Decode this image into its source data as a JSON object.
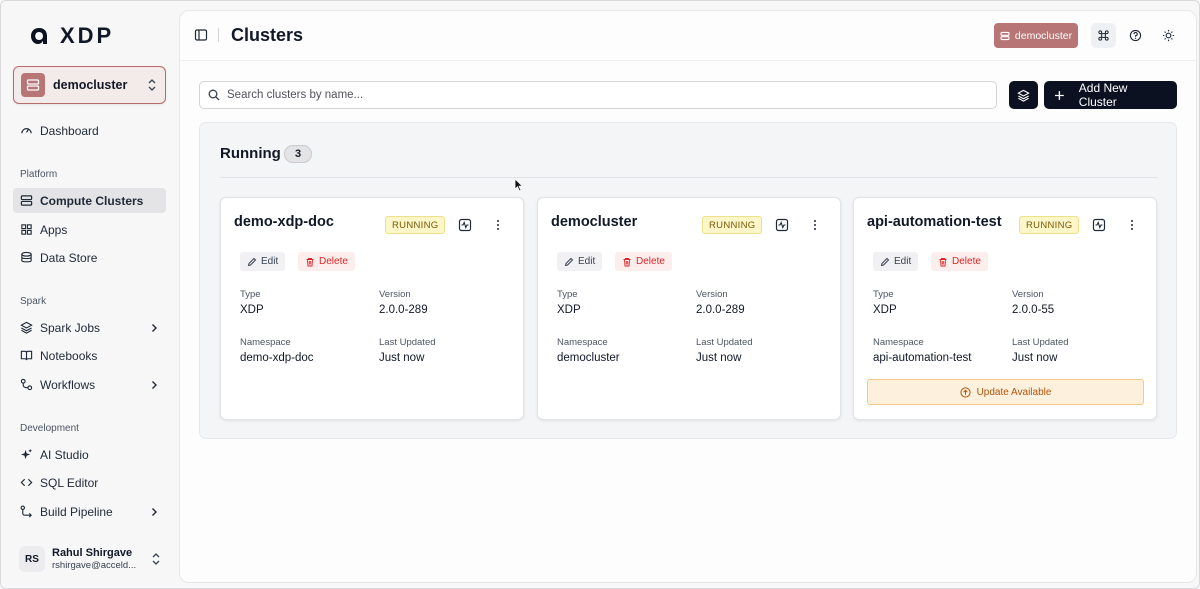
{
  "app": {
    "name": "XDP",
    "page_title": "Clusters"
  },
  "sidebar": {
    "current_cluster": "democluster",
    "items": [
      {
        "label": "Dashboard",
        "icon": "dashboard-gauge-icon"
      },
      {
        "label": "Compute Clusters",
        "icon": "server-icon"
      },
      {
        "label": "Apps",
        "icon": "apps-grid-icon"
      },
      {
        "label": "Data Store",
        "icon": "database-icon"
      },
      {
        "label": "Spark Jobs",
        "icon": "layers-icon"
      },
      {
        "label": "Notebooks",
        "icon": "book-open-icon"
      },
      {
        "label": "Workflows",
        "icon": "workflow-icon"
      },
      {
        "label": "AI Studio",
        "icon": "sparkles-icon"
      },
      {
        "label": "SQL Editor",
        "icon": "code-icon"
      },
      {
        "label": "Build Pipeline",
        "icon": "pipeline-icon"
      }
    ],
    "sections": {
      "platform": "Platform",
      "spark": "Spark",
      "development": "Development"
    },
    "user": {
      "initials": "RS",
      "name": "Rahul Shirgave",
      "email": "rshirgave@acceld..."
    }
  },
  "header": {
    "cluster_badge": "democluster"
  },
  "search": {
    "placeholder": "Search clusters by name...",
    "value": ""
  },
  "actions": {
    "add_label": "Add New Cluster"
  },
  "group": {
    "title": "Running",
    "count": "3"
  },
  "card_labels": {
    "edit": "Edit",
    "delete": "Delete",
    "type": "Type",
    "version": "Version",
    "namespace": "Namespace",
    "last_updated": "Last Updated",
    "update": "Update Available"
  },
  "clusters": [
    {
      "name": "demo-xdp-doc",
      "status": "RUNNING",
      "type": "XDP",
      "version": "2.0.0-289",
      "namespace": "demo-xdp-doc",
      "last_updated": "Just now"
    },
    {
      "name": "democluster",
      "status": "RUNNING",
      "type": "XDP",
      "version": "2.0.0-289",
      "namespace": "democluster",
      "last_updated": "Just now"
    },
    {
      "name": "api-automation-test",
      "status": "RUNNING",
      "type": "XDP",
      "version": "2.0.0-55",
      "namespace": "api-automation-test",
      "last_updated": "Just now"
    }
  ],
  "colors": {
    "accent": "#b77575",
    "primary_button": "#0b1120",
    "running_bg": "#fdf6c8",
    "update_bg": "#fdf1de",
    "danger": "#dc2626"
  }
}
